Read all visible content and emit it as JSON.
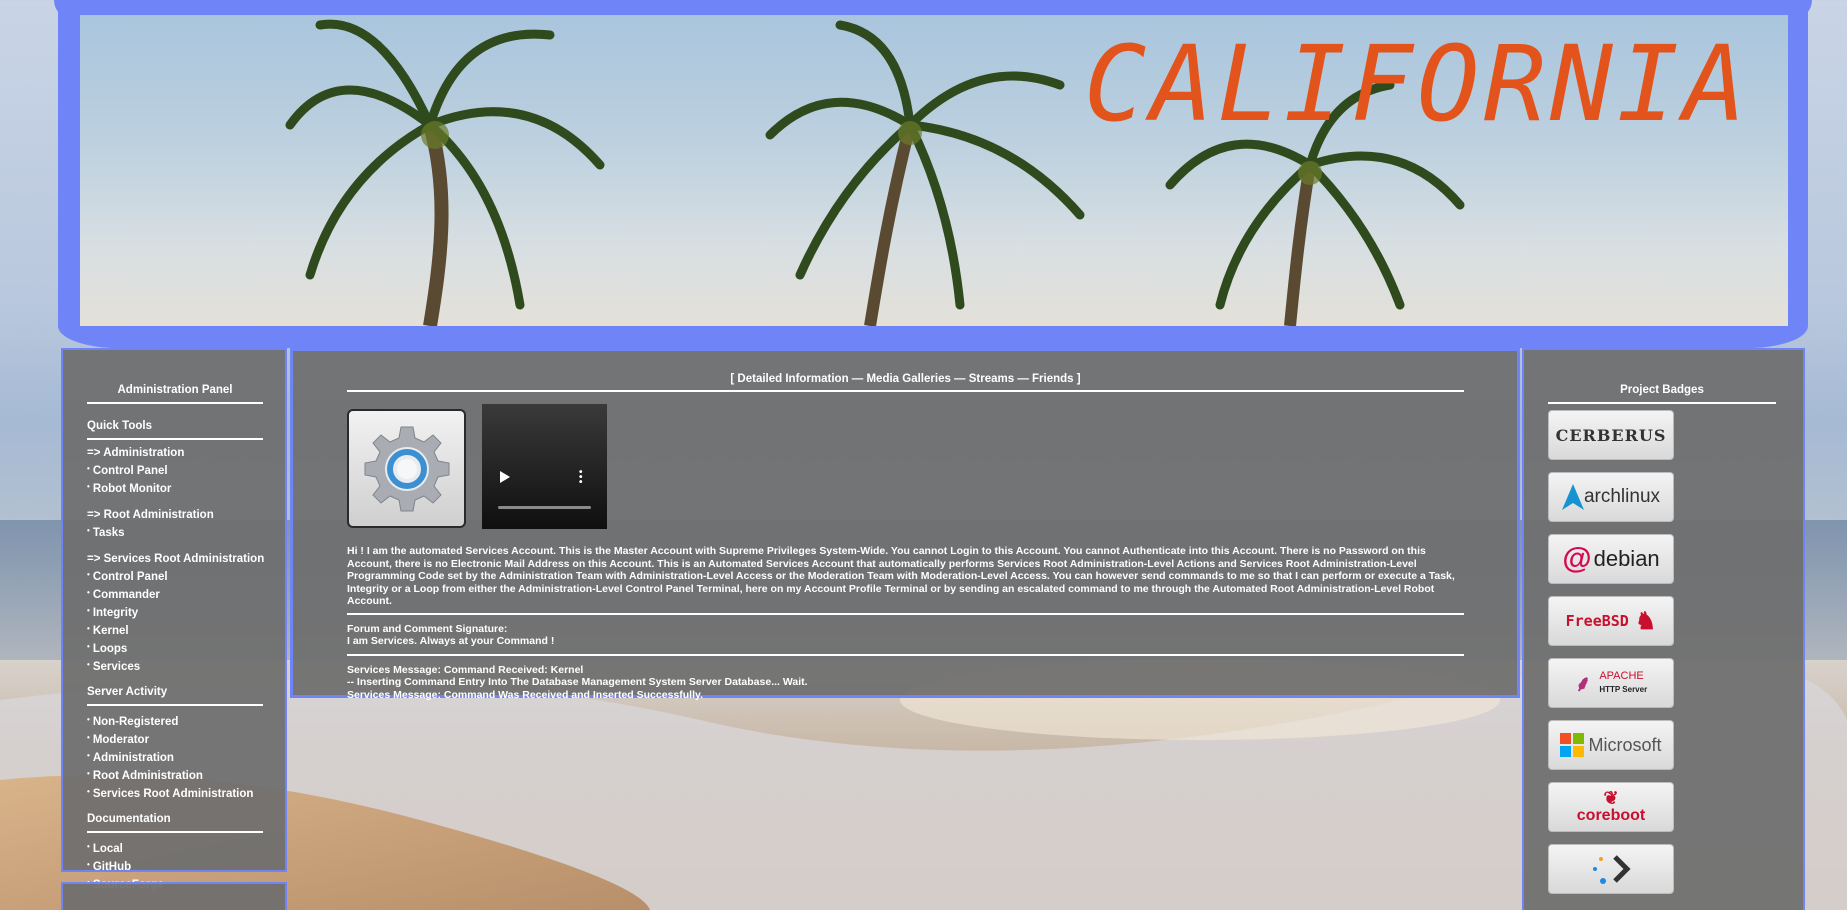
{
  "banner": {
    "title": "CALIFORNIA"
  },
  "sidebar": {
    "title": "Administration Panel",
    "quick_tools_title": "Quick Tools",
    "groups": [
      {
        "header": "=> Administration",
        "items": [
          "Control Panel",
          "Robot Monitor"
        ]
      },
      {
        "header": "=> Root Administration",
        "items": [
          "Tasks"
        ]
      },
      {
        "header": "=> Services Root Administration",
        "items": [
          "Control Panel",
          "Commander",
          "Integrity",
          "Kernel",
          "Loops",
          "Services"
        ]
      }
    ],
    "server_activity_title": "Server Activity",
    "server_activity": [
      "Non-Registered",
      "Moderator",
      "Administration",
      "Root Administration",
      "Services Root Administration"
    ],
    "documentation_title": "Documentation",
    "documentation": [
      "Local",
      "GitHub",
      "SourceForge"
    ]
  },
  "center": {
    "nav": "[  Detailed Information — Media Galleries — Streams — Friends  ]",
    "body": "Hi ! I am the automated Services Account. This is the Master Account with Supreme Privileges System-Wide. You cannot Login to this Account. You cannot Authenticate into this Account. There is no Password on this Account, there is no Electronic Mail Address on this Account. This is an Automated Services Account that automatically performs Services Root Administration-Level Actions and Services Root Administration-Level Programming Code set by the Administration Team with Administration-Level Access or the Moderation Team with Moderation-Level Access. You can however send commands to me so that I can perform or execute a Task, Integrity or a Loop from either the Administration-Level Control Panel Terminal, here on my Account Profile Terminal or by sending an escalated command to me through the Automated Root Administration-Level Robot Account.",
    "signature_label": "Forum and Comment Signature:",
    "signature": "I am Services. Always at your Command !",
    "log": [
      "Services Message: Command Received: Kernel",
      "-- Inserting Command Entry Into The Database Management System Server Database... Wait.",
      "Services Message: Command Was Received and Inserted Successfully."
    ]
  },
  "right": {
    "title": "Project Badges",
    "badges": [
      "CERBERUS",
      "archlinux",
      "debian",
      "FreeBSD",
      "APACHE",
      "HTTP Server",
      "Microsoft",
      "coreboot"
    ]
  },
  "colors": {
    "frame": "#6f84f6",
    "panel": "#6e6e6e",
    "banner_title": "#e2541c"
  },
  "icons": {
    "gear": "gear-icon",
    "play": "play-icon",
    "more": "more-vertical-icon"
  }
}
